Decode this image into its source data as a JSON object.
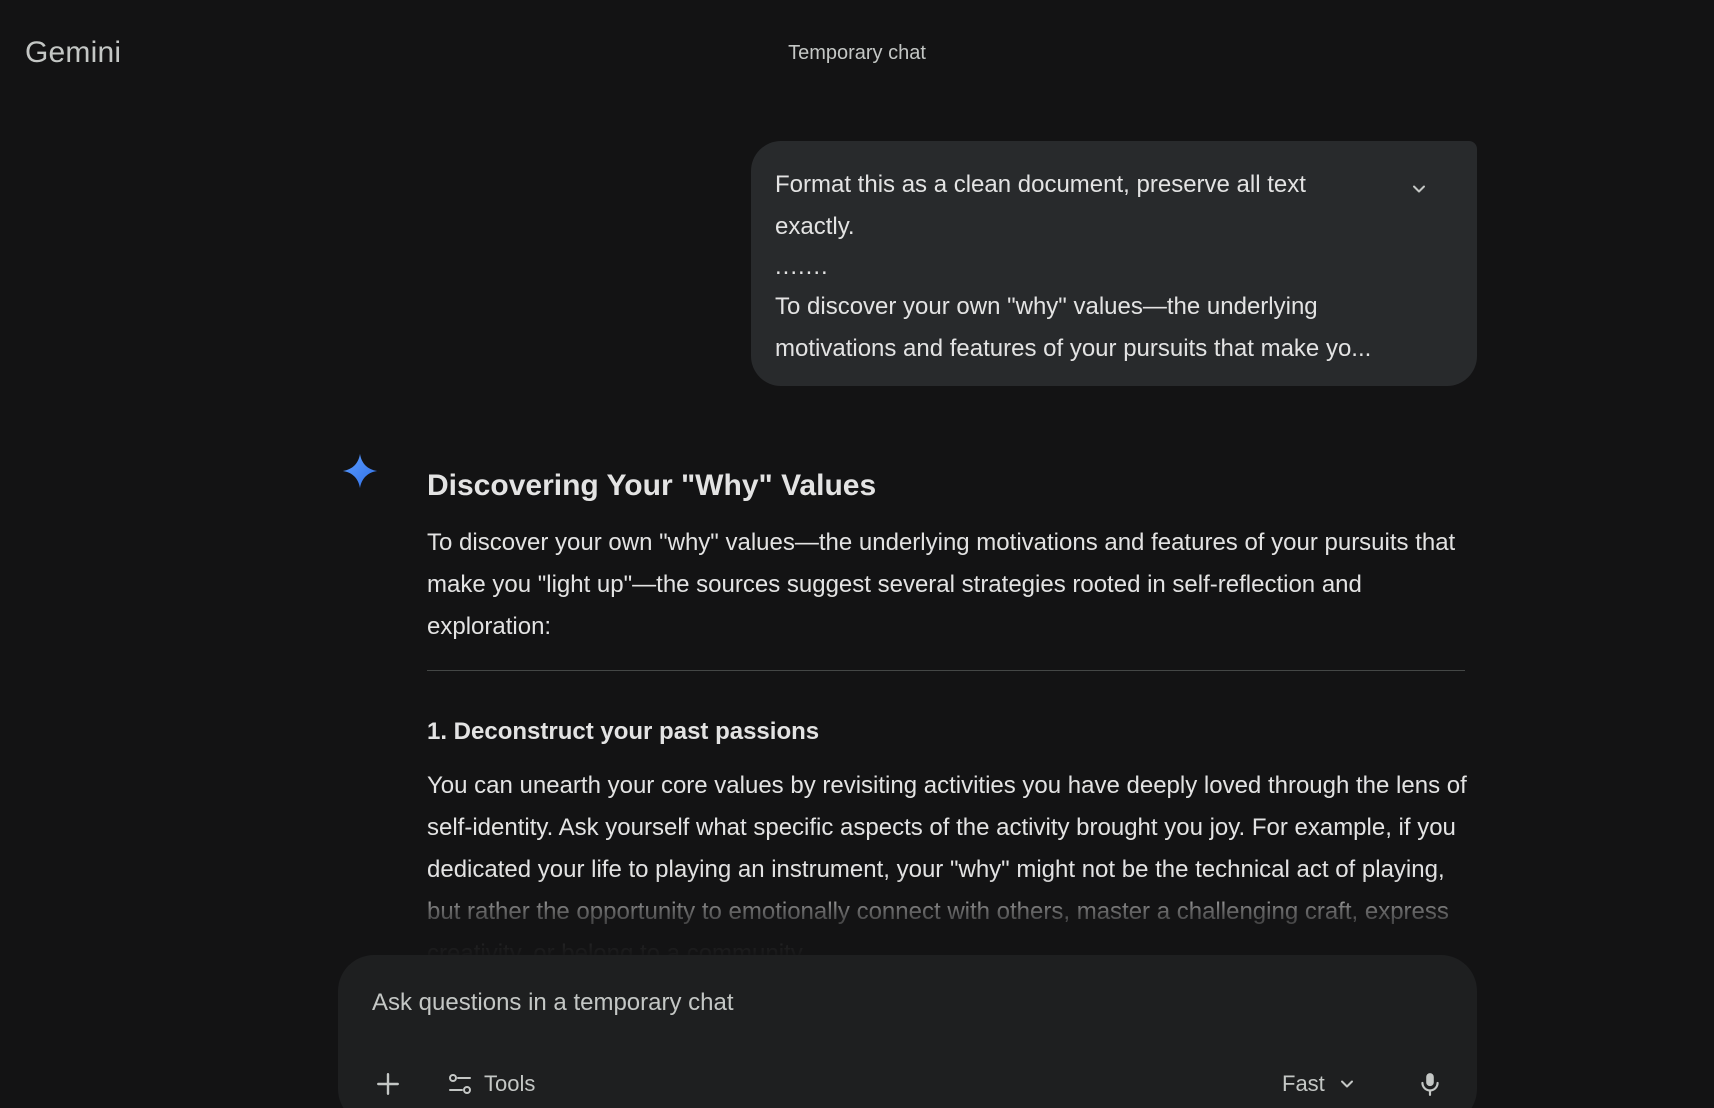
{
  "header": {
    "brand": "Gemini",
    "title": "Temporary chat"
  },
  "user_message": {
    "line1": "Format this as a clean document, preserve all text exactly.",
    "dots": ".......",
    "line2": "To discover your own \"why\" values—the underlying motivations and features of your pursuits that make yo...",
    "expand_icon": "chevron-down-icon"
  },
  "response": {
    "icon": "gemini-spark-icon",
    "title": "Discovering Your \"Why\" Values",
    "intro": "To discover your own \"why\" values—the underlying motivations and features of your pursuits that make you \"light up\"—the sources suggest several strategies rooted in self-reflection and exploration:",
    "section_title": "1. Deconstruct your past passions",
    "section_body": "You can unearth your core values by revisiting activities you have deeply loved through the lens of self-identity. Ask yourself what specific aspects of the activity brought you joy. For example, if you dedicated your life to playing an instrument, your \"why\" might not be the technical act of playing, but rather the opportunity to emotionally connect with others, master a challenging craft, express creativity, or belong to a community."
  },
  "composer": {
    "placeholder": "Ask questions in a temporary chat",
    "tools_label": "Tools",
    "model_label": "Fast",
    "icons": [
      "plus-icon",
      "tools-icon",
      "chevron-down-icon",
      "microphone-icon"
    ]
  },
  "colors": {
    "background": "#131314",
    "bubble": "#282a2c",
    "composer": "#1e1f20",
    "spark_blue": "#4a90f7"
  }
}
